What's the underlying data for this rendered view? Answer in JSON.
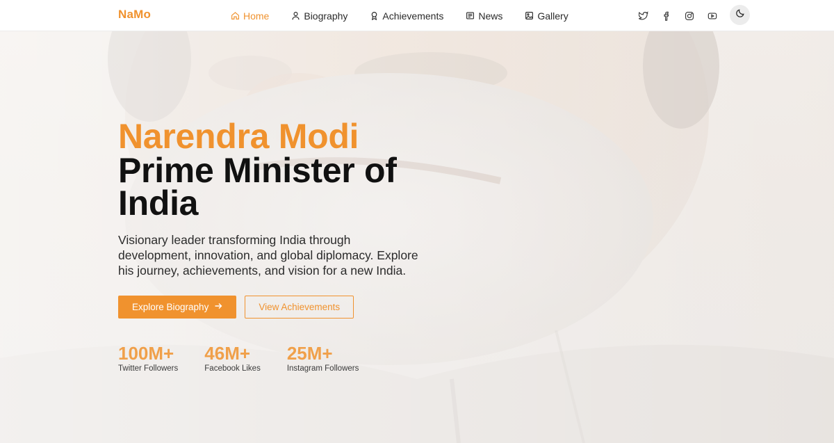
{
  "brand": "NaMo",
  "nav": {
    "items": [
      {
        "label": "Home",
        "icon": "home-icon",
        "active": true
      },
      {
        "label": "Biography",
        "icon": "user-icon",
        "active": false
      },
      {
        "label": "Achievements",
        "icon": "award-icon",
        "active": false
      },
      {
        "label": "News",
        "icon": "newspaper-icon",
        "active": false
      },
      {
        "label": "Gallery",
        "icon": "image-icon",
        "active": false
      }
    ],
    "socials": [
      "twitter-icon",
      "facebook-icon",
      "instagram-icon",
      "youtube-icon"
    ],
    "theme_toggle_icon": "moon-icon"
  },
  "hero": {
    "name": "Narendra Modi",
    "title": "Prime Minister of India",
    "description": "Visionary leader transforming India through development, innovation, and global diplomacy. Explore his journey, achievements, and vision for a new India.",
    "primary_button": "Explore Biography",
    "secondary_button": "View Achievements",
    "stats": [
      {
        "value": "100M+",
        "label": "Twitter Followers"
      },
      {
        "value": "46M+",
        "label": "Facebook Likes"
      },
      {
        "value": "25M+",
        "label": "Instagram Followers"
      }
    ]
  },
  "colors": {
    "accent": "#f0922e",
    "text": "#111111",
    "nav_bg": "#ffffff"
  }
}
